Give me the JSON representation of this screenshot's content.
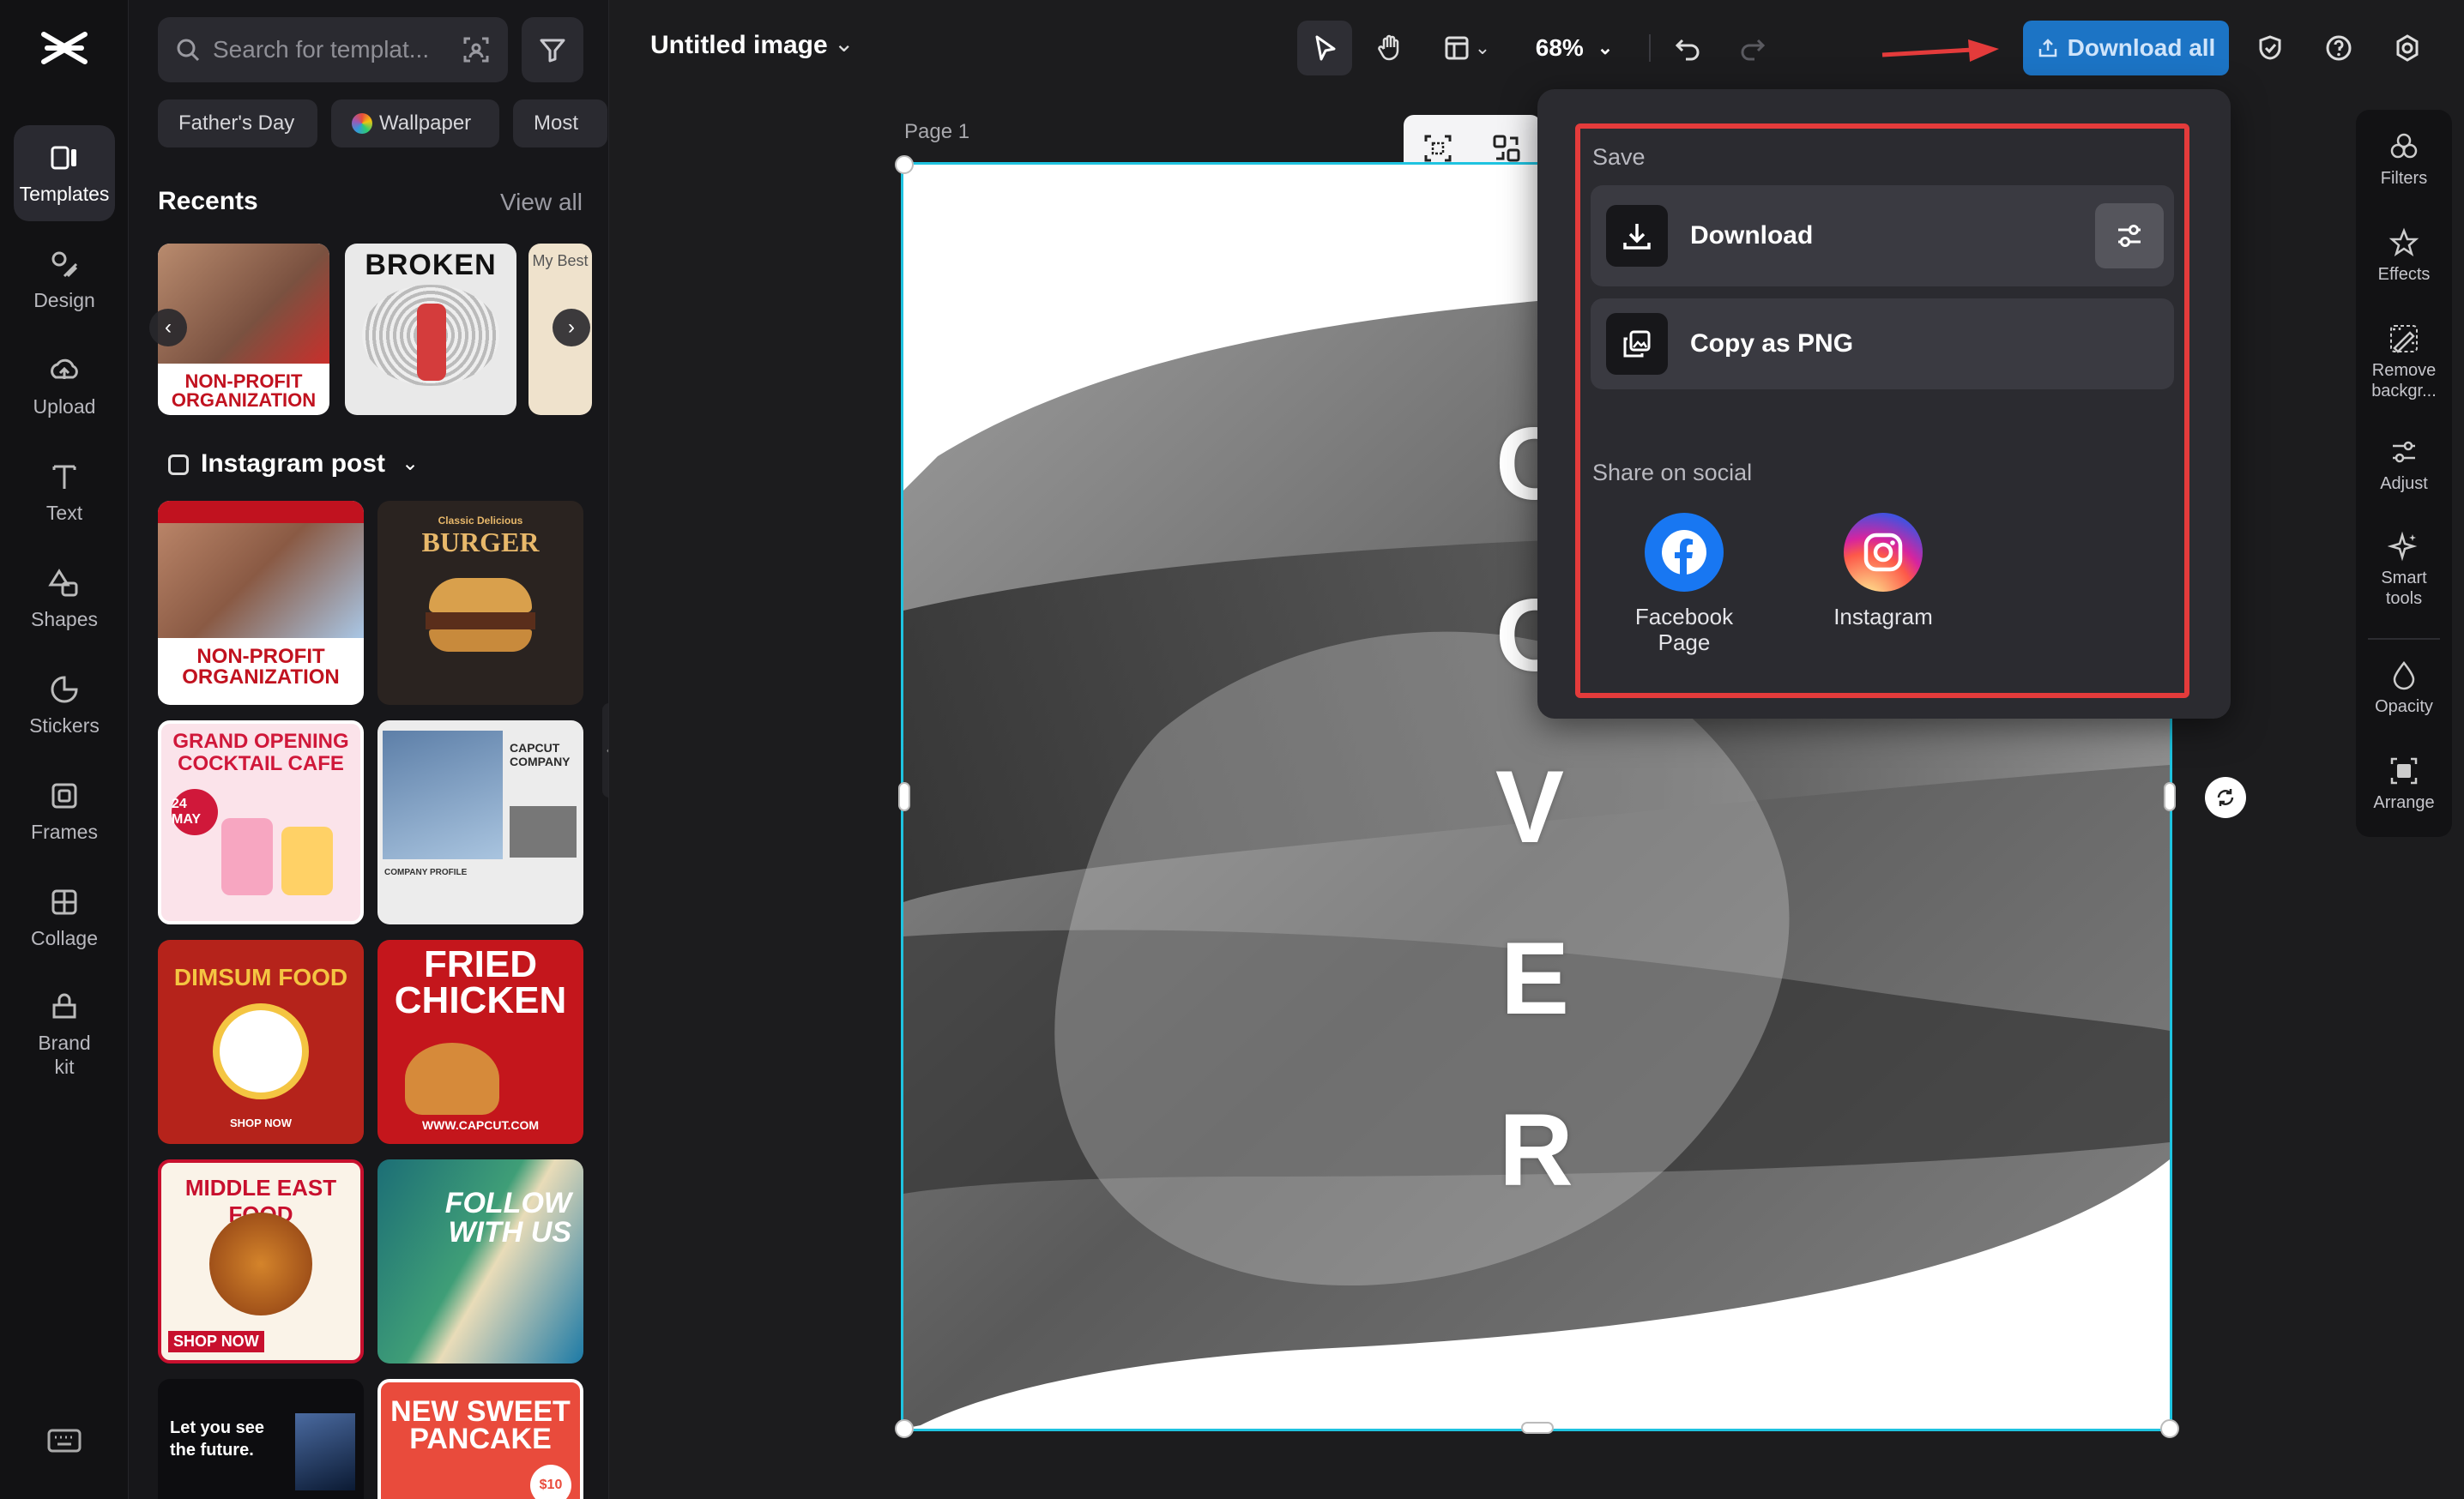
{
  "left_rail": {
    "items": [
      {
        "label": "Templates",
        "icon": "templates-icon",
        "active": true
      },
      {
        "label": "Design",
        "icon": "design-icon"
      },
      {
        "label": "Upload",
        "icon": "upload-icon"
      },
      {
        "label": "Text",
        "icon": "text-icon"
      },
      {
        "label": "Shapes",
        "icon": "shapes-icon"
      },
      {
        "label": "Stickers",
        "icon": "stickers-icon"
      },
      {
        "label": "Frames",
        "icon": "frames-icon"
      },
      {
        "label": "Collage",
        "icon": "collage-icon"
      },
      {
        "label": "Brand kit",
        "icon": "brand-kit-icon"
      }
    ]
  },
  "panel": {
    "search_placeholder": "Search for templat...",
    "chips": [
      "Father's Day",
      "Wallpaper",
      "Most"
    ],
    "recents_title": "Recents",
    "view_all": "View all",
    "recents": [
      {
        "title": "NON-PROFIT ORGANIZATION",
        "bg": "#c9302c"
      },
      {
        "title": "BROKEN",
        "bg": "#e9e9e9"
      },
      {
        "title": "My Best",
        "bg": "#efe2cc"
      }
    ],
    "section_title": "Instagram post",
    "templates": [
      {
        "title": "NON-PROFIT ORGANIZATION",
        "bg": "#ffffff",
        "accent": "#c1121f"
      },
      {
        "title": "BURGER",
        "subtitle": "Classic Delicious",
        "bg": "#2a2320",
        "accent": "#e8b86a"
      },
      {
        "title": "GRAND OPENING COCKTAIL CAFE",
        "subtitle": "24 MAY",
        "bg": "#fbe3ea",
        "accent": "#d0183a"
      },
      {
        "title": "CAPCUT COMPANY",
        "subtitle": "COMPANY PROFILE",
        "bg": "#ececec",
        "accent": "#2a2a2a"
      },
      {
        "title": "DIMSUM FOOD",
        "subtitle": "SHOP NOW",
        "bg": "#b5231b",
        "accent": "#f4c542"
      },
      {
        "title": "FRIED CHICKEN",
        "subtitle": "WWW.CAPCUT.COM",
        "bg": "#c4161c",
        "accent": "#ffffff"
      },
      {
        "title": "MIDDLE EAST FOOD",
        "subtitle": "SHOP NOW",
        "bg": "#faf3e8",
        "accent": "#c8102e"
      },
      {
        "title": "FOLLOW WITH US",
        "bg": "#1f7a7a",
        "accent": "#ffffff"
      },
      {
        "title": "Let you see the future.",
        "bg": "#0d0d10",
        "accent": "#ffffff"
      },
      {
        "title": "NEW SWEET PANCAKE",
        "subtitle": "$10",
        "bg": "#e94b3c",
        "accent": "#ffffff"
      }
    ]
  },
  "topbar": {
    "doc_title": "Untitled image",
    "zoom": "68%",
    "download_all": "Download all"
  },
  "canvas": {
    "page_label": "Page 1",
    "cover_letters": [
      "C",
      "O",
      "V",
      "E",
      "R"
    ]
  },
  "download_popup": {
    "save_label": "Save",
    "download_label": "Download",
    "copy_label": "Copy as PNG",
    "share_label": "Share on social",
    "socials": [
      {
        "name": "Facebook Page",
        "icon": "facebook-icon"
      },
      {
        "name": "Instagram",
        "icon": "instagram-icon"
      }
    ]
  },
  "right_rail": {
    "items": [
      {
        "label": "Filters",
        "icon": "filters-icon"
      },
      {
        "label": "Effects",
        "icon": "effects-icon"
      },
      {
        "label": "Remove backgr...",
        "icon": "remove-background-icon"
      },
      {
        "label": "Adjust",
        "icon": "adjust-icon"
      },
      {
        "label": "Smart tools",
        "icon": "smart-tools-icon"
      },
      {
        "label": "Opacity",
        "icon": "opacity-icon"
      },
      {
        "label": "Arrange",
        "icon": "arrange-icon"
      }
    ]
  },
  "colors": {
    "accent": "#1c74c5",
    "selection": "#1fc3e0",
    "highlight": "#e43b3b"
  }
}
